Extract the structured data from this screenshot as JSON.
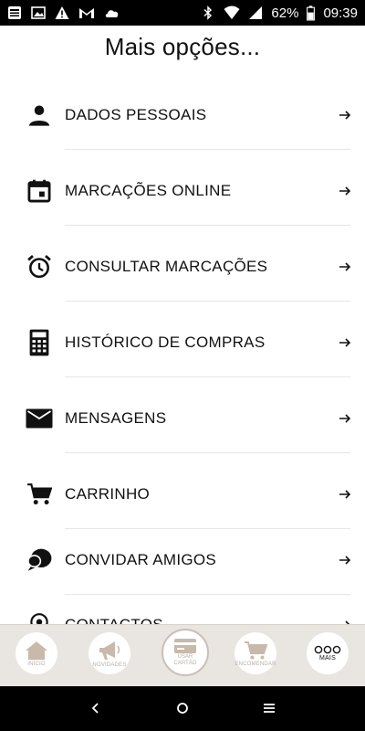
{
  "status_bar": {
    "battery": "62%",
    "time": "09:39",
    "left_icons": [
      "news-icon",
      "image-icon",
      "warning-icon",
      "gmail-icon",
      "cloud-icon"
    ],
    "right_icons": [
      "bluetooth-icon",
      "wifi-icon",
      "signal-icon",
      "battery-icon"
    ]
  },
  "page": {
    "title": "Mais opções..."
  },
  "menu": {
    "items": [
      {
        "label": "DADOS PESSOAIS",
        "icon": "person-icon"
      },
      {
        "label": "MARCAÇÕES ONLINE",
        "icon": "calendar-icon"
      },
      {
        "label": "CONSULTAR MARCAÇÕES",
        "icon": "alarm-clock-icon"
      },
      {
        "label": "HISTÓRICO DE COMPRAS",
        "icon": "calculator-icon"
      },
      {
        "label": "MENSAGENS",
        "icon": "envelope-icon"
      },
      {
        "label": "CARRINHO",
        "icon": "cart-icon"
      },
      {
        "label": "CONVIDAR AMIGOS",
        "icon": "chat-bubbles-icon"
      },
      {
        "label": "CONTACTOS",
        "icon": "location-pin-icon"
      }
    ]
  },
  "tab_bar": {
    "tabs": [
      {
        "label": "INÍCIO",
        "icon": "home-icon"
      },
      {
        "label": "NOVIDADES",
        "icon": "megaphone-icon"
      },
      {
        "label": "USAR CARTÃO",
        "icon": "card-icon"
      },
      {
        "label": "ENCOMENDAR",
        "icon": "cart-icon"
      },
      {
        "label": "MAIS",
        "icon": "more-dots-icon"
      }
    ]
  },
  "colors": {
    "status_bar": "#000000",
    "tab_bar": "#e9e5e1",
    "tab_icon": "#c9b9ab",
    "text": "#111111"
  }
}
